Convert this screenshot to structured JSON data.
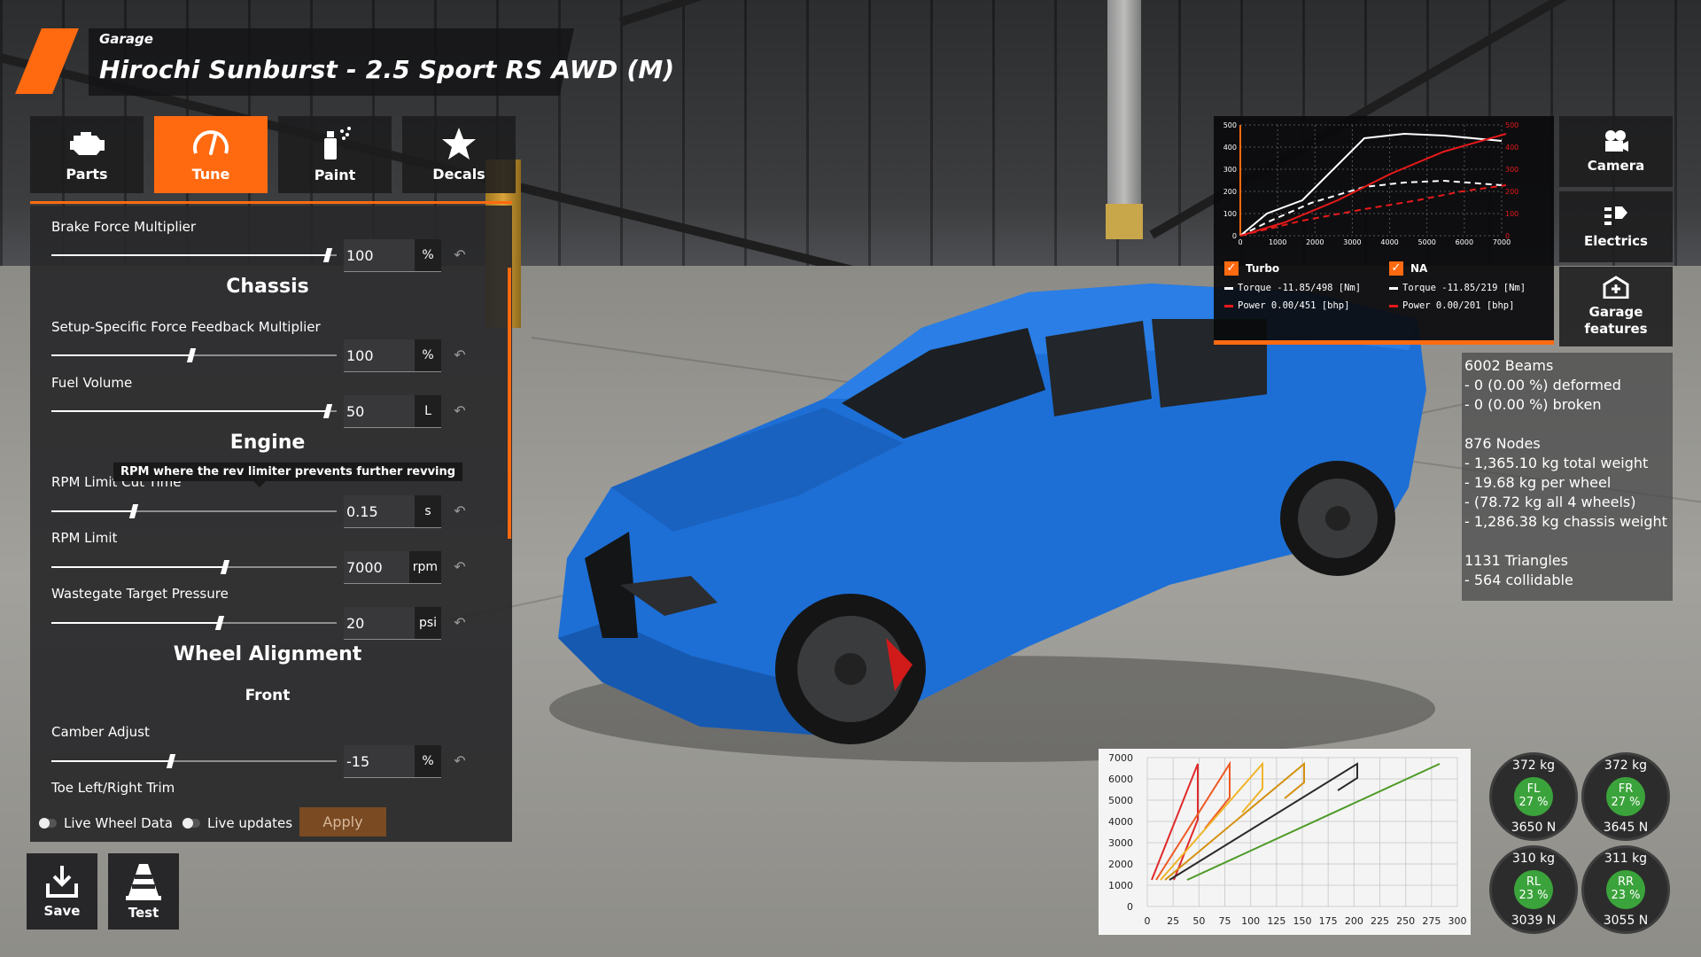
{
  "header": {
    "subtitle": "Garage",
    "title": "Hirochi Sunburst - 2.5 Sport RS AWD (M)"
  },
  "tabs": [
    {
      "label": "Parts",
      "icon": "engine-icon",
      "active": false
    },
    {
      "label": "Tune",
      "icon": "gauge-icon",
      "active": true
    },
    {
      "label": "Paint",
      "icon": "spray-can-icon",
      "active": false
    },
    {
      "label": "Decals",
      "icon": "star-icon",
      "active": false
    }
  ],
  "tune": {
    "rows": [
      {
        "label": "Brake Force Multiplier",
        "value": "100",
        "unit": "%",
        "level": 0.97
      },
      {
        "label": "Setup-Specific Force Feedback Multiplier",
        "value": "100",
        "unit": "%",
        "level": 0.49
      },
      {
        "label": "Fuel Volume",
        "value": "50",
        "unit": "L",
        "level": 0.97
      },
      {
        "label": "RPM Limit Cut Time",
        "value": "0.15",
        "unit": "s",
        "level": 0.29
      },
      {
        "label": "RPM Limit",
        "value": "7000",
        "unit": "rpm",
        "level": 0.61
      },
      {
        "label": "Wastegate Target Pressure",
        "value": "20",
        "unit": "psi",
        "level": 0.59
      },
      {
        "label": "Camber Adjust",
        "value": "-15",
        "unit": "%",
        "level": 0.42
      },
      {
        "label": "Toe Left/Right Trim",
        "value": "",
        "unit": "",
        "level": 0
      }
    ],
    "sections": {
      "chassis": "Chassis",
      "engine": "Engine",
      "wheel_alignment": "Wheel Alignment",
      "front": "Front"
    },
    "tooltip": "RPM where the rev limiter prevents further revving",
    "live_wheel_data": "Live Wheel Data",
    "live_updates": "Live updates",
    "apply": "Apply"
  },
  "bottom_buttons": {
    "save": "Save",
    "test": "Test"
  },
  "side_buttons": {
    "camera": "Camera",
    "electrics": "Electrics",
    "garage_features_1": "Garage",
    "garage_features_2": "features"
  },
  "torque_graph": {
    "y_ticks": [
      "500",
      "400",
      "300",
      "200",
      "100",
      "0"
    ],
    "x_ticks": [
      "0",
      "1000",
      "2000",
      "3000",
      "4000",
      "5000",
      "6000",
      "7000"
    ],
    "turbo": {
      "label": "Turbo",
      "torque": "Torque -11.85/498 [Nm]",
      "power": "Power 0.00/451   [bhp]"
    },
    "na": {
      "label": "NA",
      "torque": "Torque -11.85/219 [Nm]",
      "power": "Power 0.00/201   [bhp]"
    },
    "colors": {
      "torque": "#ffffff",
      "power": "#e8191a"
    }
  },
  "stats": {
    "beams": "6002 Beams",
    "deformed": "- 0 (0.00 %) deformed",
    "broken": "- 0 (0.00 %) broken",
    "nodes": "876 Nodes",
    "total_weight": "- 1,365.10 kg total weight",
    "per_wheel": "- 19.68 kg per wheel",
    "all_wheels": "- (78.72 kg all 4 wheels)",
    "chassis_weight": "- 1,286.38 kg chassis weight",
    "triangles": "1131 Triangles",
    "collidable": "- 564 collidable"
  },
  "gear_chart": {
    "y_ticks": [
      "7000",
      "6000",
      "5000",
      "4000",
      "3000",
      "2000",
      "1000",
      "0"
    ],
    "x_ticks": [
      "0",
      "25",
      "50",
      "75",
      "100",
      "125",
      "150",
      "175",
      "200",
      "225",
      "250",
      "275",
      "300"
    ]
  },
  "wheels": [
    {
      "pos": "FL",
      "kg": "372  kg",
      "pct": "27 %",
      "n": "3650  N"
    },
    {
      "pos": "FR",
      "kg": "372  kg",
      "pct": "27 %",
      "n": "3645  N"
    },
    {
      "pos": "RL",
      "kg": "310  kg",
      "pct": "23 %",
      "n": "3039  N"
    },
    {
      "pos": "RR",
      "kg": "311  kg",
      "pct": "23 %",
      "n": "3055  N"
    }
  ],
  "colors": {
    "accent": "#ff6a10",
    "car": "#1d6fd6",
    "wheel_ok": "#3ba33b"
  }
}
